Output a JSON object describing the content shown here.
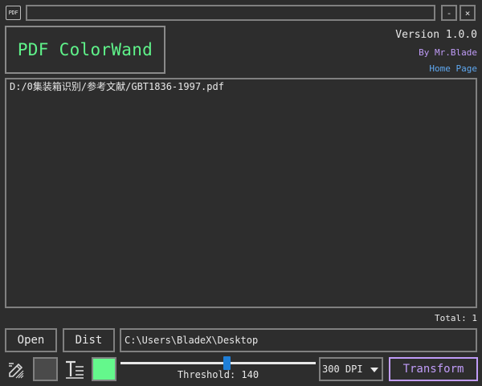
{
  "titlebar": {
    "app_icon_text": "PDF",
    "title": "",
    "minimize_label": "-",
    "close_label": "×"
  },
  "header": {
    "logo_text": "PDF ColorWand",
    "version": "Version 1.0.0",
    "author": "By Mr.Blade",
    "homepage_link": "Home Page"
  },
  "file_list": {
    "items": [
      "D:/0集装箱识别/参考文献/GBT1836-1997.pdf"
    ],
    "total_label": "Total: 1"
  },
  "controls": {
    "open_label": "Open",
    "dist_label": "Dist",
    "output_path": "C:\\Users\\BladeX\\Desktop",
    "background_color": "#4a4a4a",
    "foreground_color": "#64f88c",
    "threshold_label": "Threshold: 140",
    "threshold_value": 140,
    "threshold_max": 255,
    "dpi_selected": "300 DPI",
    "transform_label": "Transform"
  },
  "icons": {
    "pen": "pen-eraser-icon",
    "text": "text-format-icon",
    "dropdown": "chevron-down-icon"
  },
  "colors": {
    "logo_text": "#5ff38a",
    "accent_purple": "#c09cf8",
    "link_blue": "#5fa8f0",
    "slider_thumb": "#1f7fd8"
  }
}
